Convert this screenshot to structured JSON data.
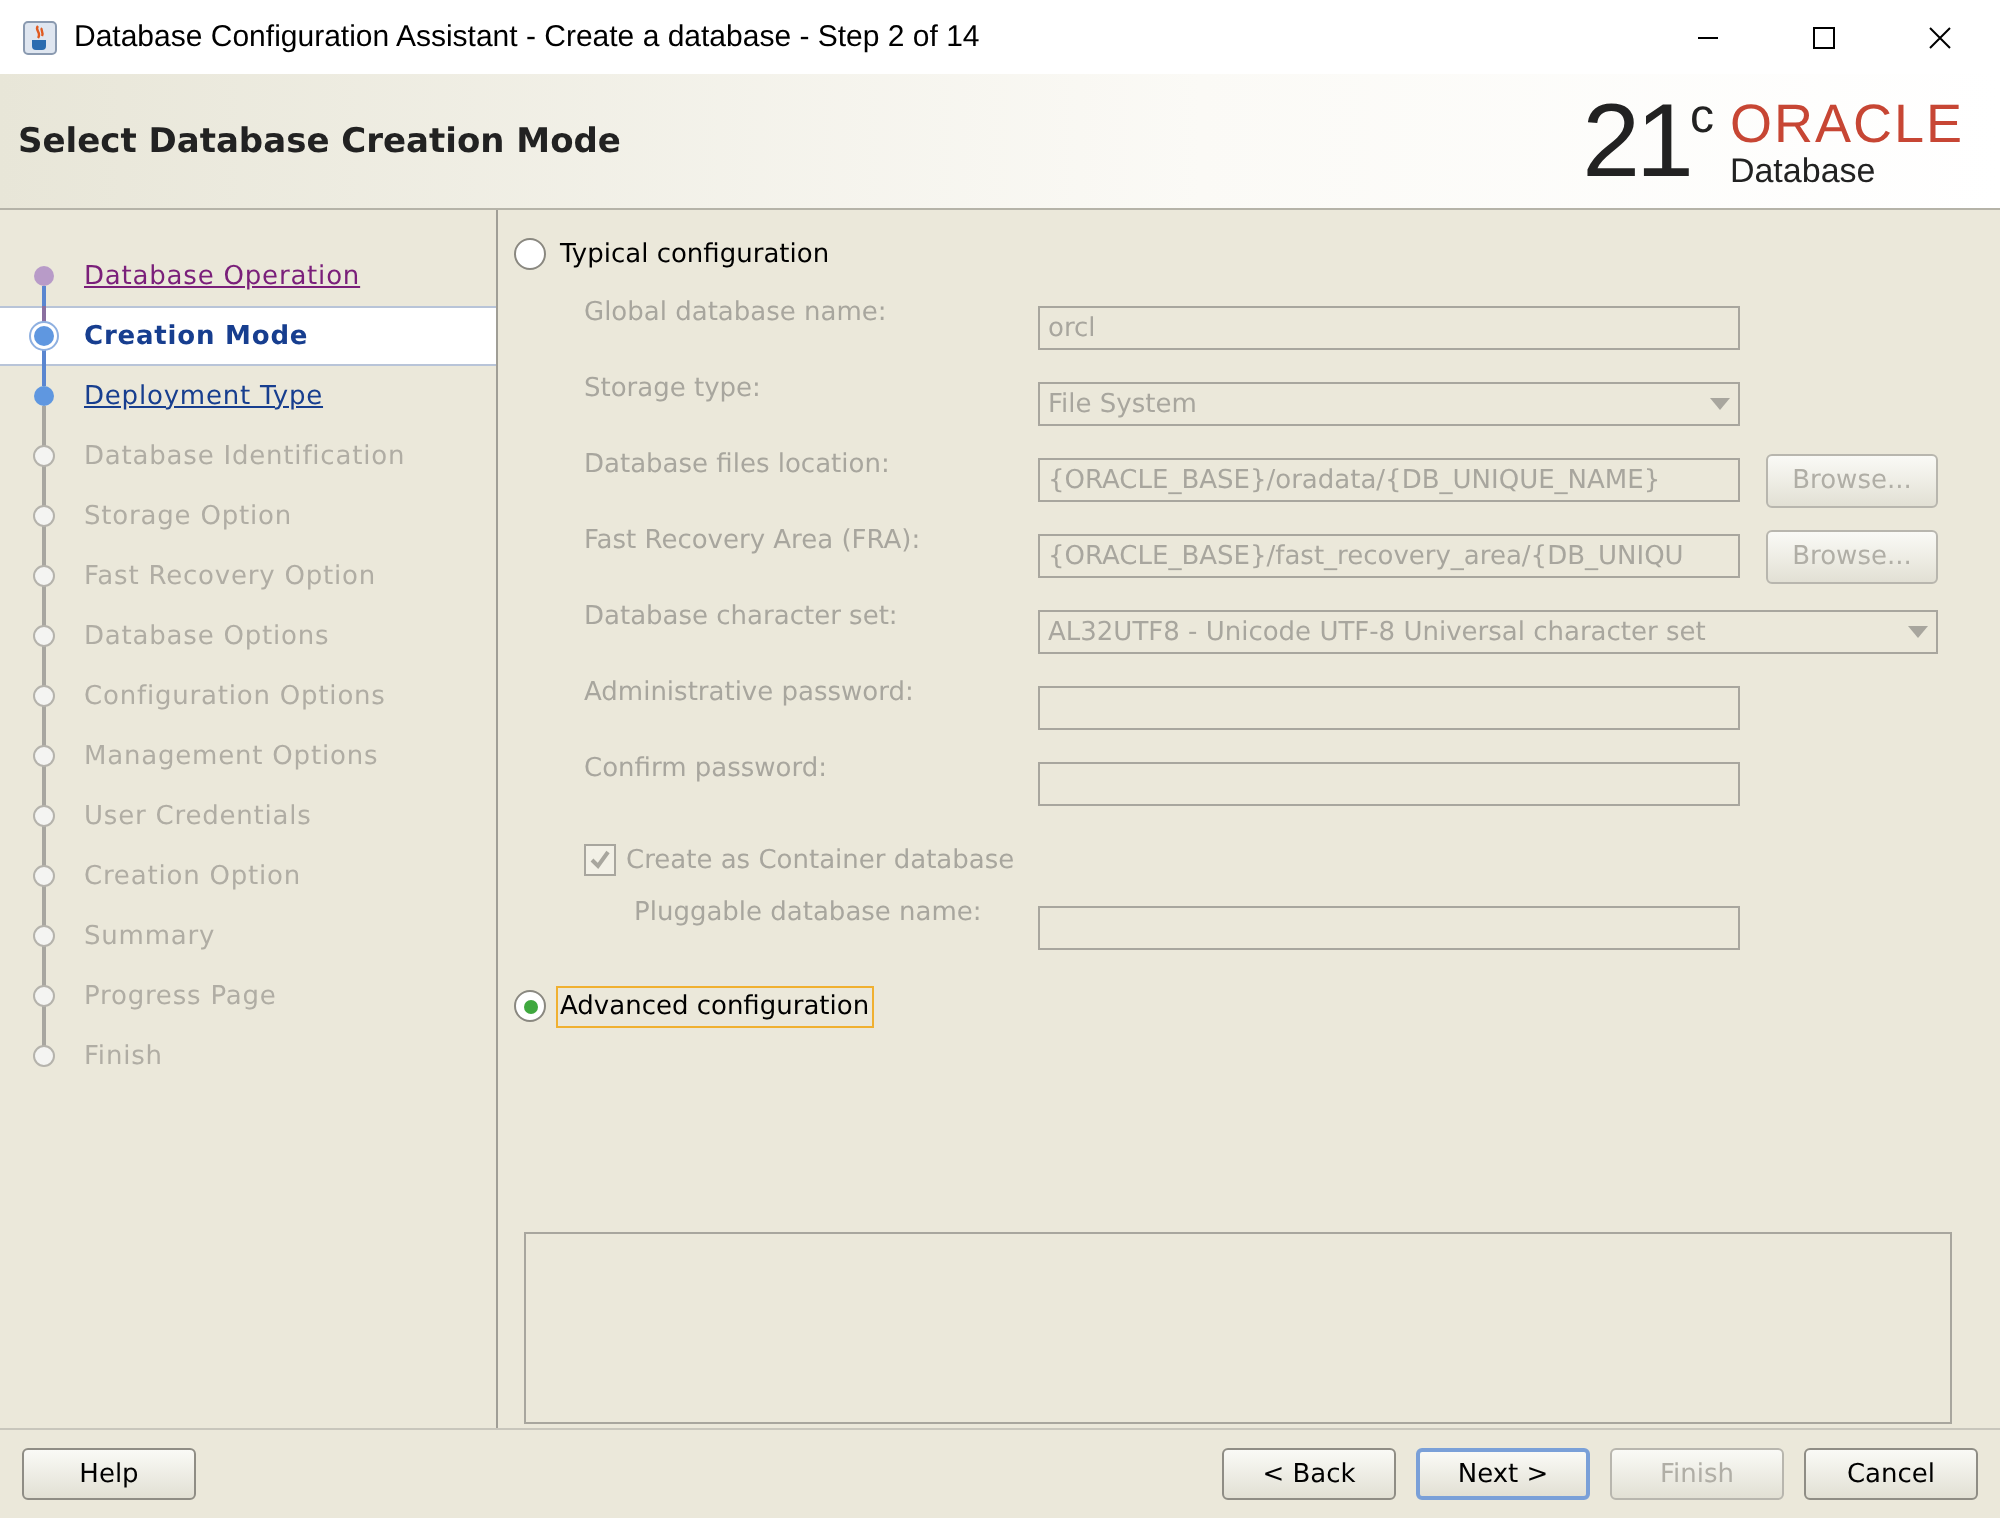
{
  "window": {
    "title": "Database Configuration Assistant - Create a database - Step 2 of 14"
  },
  "header": {
    "title": "Select Database Creation Mode",
    "logo_version": "21",
    "logo_superscript": "c",
    "logo_brand": "ORACLE",
    "logo_product": "Database"
  },
  "steps": [
    {
      "label": "Database Operation",
      "kind": "visited",
      "selected": false
    },
    {
      "label": "Creation Mode",
      "kind": "current",
      "selected": true
    },
    {
      "label": "Deployment Type",
      "kind": "next",
      "selected": false
    },
    {
      "label": "Database Identification",
      "kind": "disabled",
      "selected": false
    },
    {
      "label": "Storage Option",
      "kind": "disabled",
      "selected": false
    },
    {
      "label": "Fast Recovery Option",
      "kind": "disabled",
      "selected": false
    },
    {
      "label": "Database Options",
      "kind": "disabled",
      "selected": false
    },
    {
      "label": "Configuration Options",
      "kind": "disabled",
      "selected": false
    },
    {
      "label": "Management Options",
      "kind": "disabled",
      "selected": false
    },
    {
      "label": "User Credentials",
      "kind": "disabled",
      "selected": false
    },
    {
      "label": "Creation Option",
      "kind": "disabled",
      "selected": false
    },
    {
      "label": "Summary",
      "kind": "disabled",
      "selected": false
    },
    {
      "label": "Progress Page",
      "kind": "disabled",
      "selected": false
    },
    {
      "label": "Finish",
      "kind": "disabled",
      "selected": false
    }
  ],
  "typical": {
    "label": "Typical configuration",
    "selected": false,
    "fields": [
      {
        "kind": "text",
        "label": "Global database name:",
        "value": "orcl",
        "wide": false
      },
      {
        "kind": "select",
        "label": "Storage type:",
        "value": "File System",
        "wide": false
      },
      {
        "kind": "browse",
        "label": "Database files location:",
        "value": "{ORACLE_BASE}/oradata/{DB_UNIQUE_NAME}",
        "button": "Browse...",
        "wide": false
      },
      {
        "kind": "browse",
        "label": "Fast Recovery Area (FRA):",
        "value": "{ORACLE_BASE}/fast_recovery_area/{DB_UNIQU",
        "button": "Browse...",
        "wide": false
      },
      {
        "kind": "select",
        "label": "Database character set:",
        "value": "AL32UTF8 - Unicode UTF-8 Universal character set",
        "wide": true
      },
      {
        "kind": "text",
        "label": "Administrative password:",
        "wide": false
      },
      {
        "kind": "text",
        "label": "Confirm password:",
        "wide": false
      }
    ],
    "container": {
      "label": "Create as Container database",
      "checked": true
    },
    "pluggable": {
      "label": "Pluggable database name:"
    }
  },
  "advanced": {
    "label": "Advanced configuration",
    "selected": true
  },
  "buttons": [
    {
      "label": "Help",
      "disabled": false,
      "default": false
    },
    {
      "label": "< Back",
      "disabled": false,
      "default": false
    },
    {
      "label": "Next >",
      "disabled": false,
      "default": true
    },
    {
      "label": "Finish",
      "disabled": true,
      "default": false
    },
    {
      "label": "Cancel",
      "disabled": false,
      "default": false
    }
  ]
}
